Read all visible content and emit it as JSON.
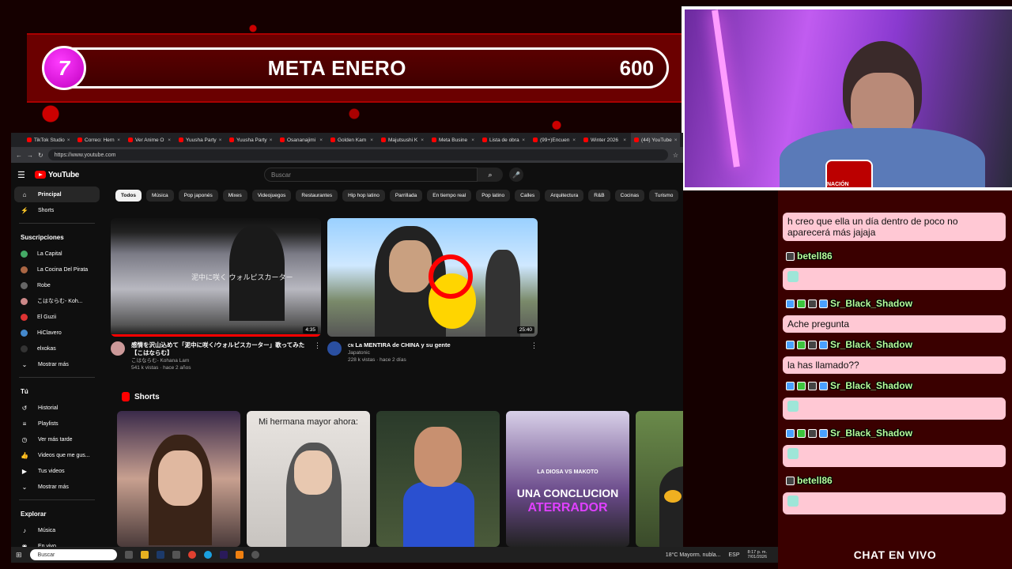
{
  "meta": {
    "count": "7",
    "title": "META ENERO",
    "goal": "600"
  },
  "webcam": {
    "logo_text": "NACIÓN AKACHAN"
  },
  "tabs": [
    "TikTok Studio",
    "Correo: Hern",
    "Ver Anime O",
    "Yuusha Party",
    "Yuusha Party",
    "Osananajimi",
    "Golden Kam",
    "Majutsushi K",
    "Meta Busine",
    "Lista de obra",
    "(99+)Encuen",
    "Winter 2026",
    "(44) YouTube"
  ],
  "address": {
    "url": "https://www.youtube.com"
  },
  "yt": {
    "logo": "YouTube",
    "search_placeholder": "Buscar",
    "chips": [
      "Todos",
      "Música",
      "Pop japonés",
      "Mixes",
      "Videojuegos",
      "Restaurantes",
      "Hip hop latino",
      "Parrillada",
      "En tiempo real",
      "Pop latino",
      "Calles",
      "Arquitectura",
      "R&B",
      "Cocinas",
      "Turismo",
      "Anime",
      "Juegos d"
    ],
    "sidebar": {
      "main": [
        "Principal",
        "Shorts"
      ],
      "subs_title": "Suscripciones",
      "subs": [
        "La Capital",
        "La Cocina Del Pirata",
        "Robe",
        "こはならむ- Koh...",
        "El Guzii",
        "HiClavero",
        "elxokas",
        "Mostrar más"
      ],
      "you_title": "Tú",
      "you": [
        "Historial",
        "Playlists",
        "Ver más tarde",
        "Videos que me gus...",
        "Tus videos",
        "Mostrar más"
      ],
      "explore_title": "Explorar",
      "explore": [
        "Música",
        "En vivo"
      ]
    },
    "videos": [
      {
        "title": "感情を沢山込めて「泥中に咲く/ウォルピスカーター」歌ってみた【こはならむ】",
        "channel": "こはならむ- Kohana Lam",
        "meta": "541 k vistas · hace 2 años",
        "duration": "4:35",
        "thumb_text": "泥中に咲く ウォルピスカーター"
      },
      {
        "title": "La MENTIRA de CHINA y su gente",
        "channel": "Japatonic",
        "meta": "228 k vistas · hace 2 días",
        "duration": "25:40",
        "badge": "CN"
      }
    ],
    "shorts_title": "Shorts",
    "shorts": [
      {
        "text": ""
      },
      {
        "text": "Mi hermana mayor ahora:"
      },
      {
        "text": ""
      },
      {
        "text_top": "LA DIOSA VS MAKOTO",
        "text": "UNA CONCLUCION",
        "text2": "ATERRADOR"
      },
      {
        "text": ""
      }
    ]
  },
  "taskbar": {
    "search": "Buscar",
    "weather": "18°C  Mayorm. nubla...",
    "lang": "ESP",
    "time": "8:17 p. m.",
    "date": "7/01/2026"
  },
  "chat": {
    "messages": [
      {
        "type": "text",
        "text": "h creo que ella un día dentro de poco no aparecerá más jajaja"
      },
      {
        "type": "user",
        "user": "betell86"
      },
      {
        "type": "emote"
      },
      {
        "type": "user",
        "user": "Sr_Black_Shadow"
      },
      {
        "type": "text",
        "text": "Ache pregunta"
      },
      {
        "type": "user",
        "user": "Sr_Black_Shadow"
      },
      {
        "type": "text",
        "text": "la has llamado??"
      },
      {
        "type": "user",
        "user": "Sr_Black_Shadow"
      },
      {
        "type": "emote"
      },
      {
        "type": "user",
        "user": "Sr_Black_Shadow"
      },
      {
        "type": "emote"
      },
      {
        "type": "user",
        "user": "betell86"
      },
      {
        "type": "emote"
      }
    ],
    "footer": "CHAT EN VIVO"
  }
}
